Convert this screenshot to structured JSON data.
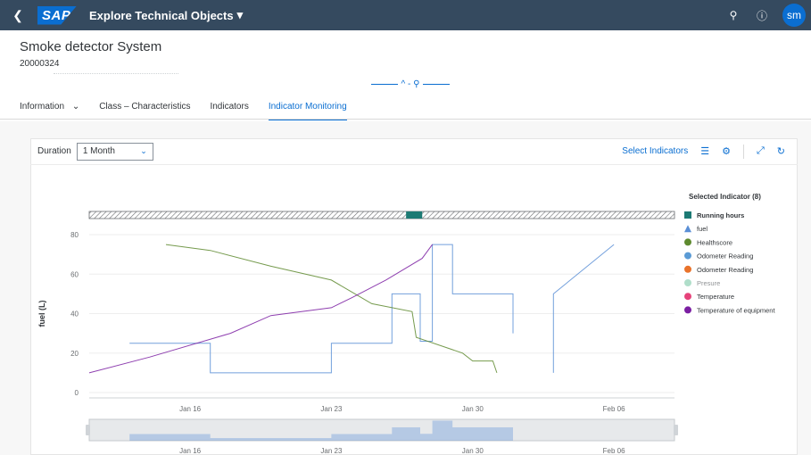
{
  "shell": {
    "title": "Explore Technical Objects",
    "logo": "SAP",
    "avatar_initials": "sm",
    "icons": [
      "back-icon",
      "search-icon",
      "help-icon"
    ]
  },
  "header": {
    "title": "Smoke detector System",
    "id": "20000324",
    "collapse_glyphs": "^ - ⚲"
  },
  "tabs": [
    {
      "label": "Information",
      "has_menu": true
    },
    {
      "label": "Class – Characteristics"
    },
    {
      "label": "Indicators"
    },
    {
      "label": "Indicator Monitoring",
      "active": true
    }
  ],
  "toolbar": {
    "duration_label": "Duration",
    "duration_value": "1 Month",
    "select_indicators": "Select Indicators"
  },
  "colors": {
    "shell_bg": "#354a5f",
    "accent": "#0a6ed1",
    "running_hours": "#1d7a74",
    "fuel": "#5a8fd6",
    "healthscore": "#5e8a2f",
    "odometer1": "#5b9bd5",
    "odometer2": "#e9732b",
    "presure": "#8fd0b4",
    "temperature": "#e6427a",
    "temp_equipment": "#7b1fa2"
  },
  "chart_data": {
    "type": "line",
    "ylabel": "fuel (L)",
    "ylim": [
      0,
      80
    ],
    "yticks": [
      0,
      20,
      40,
      60,
      80
    ],
    "x_ticks": [
      "Jan 16",
      "Jan 23",
      "Jan 30",
      "Feb 06"
    ],
    "legend_title": "Selected Indicator (8)",
    "legend": [
      {
        "name": "Running hours",
        "marker": "square",
        "color_key": "running_hours",
        "bold": true
      },
      {
        "name": "fuel",
        "marker": "triangle",
        "color_key": "fuel"
      },
      {
        "name": "Healthscore",
        "marker": "circle",
        "color_key": "healthscore"
      },
      {
        "name": "Odometer Reading",
        "marker": "circle",
        "color_key": "odometer1"
      },
      {
        "name": "Odometer Reading",
        "marker": "circle",
        "color_key": "odometer2"
      },
      {
        "name": "Presure",
        "marker": "circle",
        "color_key": "presure",
        "faded": true
      },
      {
        "name": "Temperature",
        "marker": "circle",
        "color_key": "temperature"
      },
      {
        "name": "Temperature of equipment",
        "marker": "circle",
        "color_key": "temp_equipment"
      }
    ],
    "x_domain": [
      11,
      40
    ],
    "series": [
      {
        "name": "fuel",
        "color_key": "fuel",
        "step": true,
        "points": [
          [
            13,
            25
          ],
          [
            17,
            25
          ],
          [
            17,
            10
          ],
          [
            23,
            10
          ],
          [
            23,
            25
          ],
          [
            26,
            25
          ],
          [
            26,
            50
          ],
          [
            27.4,
            50
          ],
          [
            27.4,
            26
          ],
          [
            28,
            26
          ],
          [
            28,
            75
          ],
          [
            29,
            75
          ],
          [
            29,
            50
          ],
          [
            32,
            50
          ],
          [
            32,
            30
          ]
        ]
      },
      {
        "name": "fuel",
        "color_key": "fuel",
        "step": true,
        "points": [
          [
            34,
            10
          ],
          [
            34,
            50
          ],
          [
            37,
            75
          ]
        ]
      },
      {
        "name": "Healthscore",
        "color_key": "healthscore",
        "step": false,
        "points": [
          [
            14.8,
            75
          ],
          [
            17,
            72
          ],
          [
            20,
            64
          ],
          [
            23,
            57
          ],
          [
            24,
            51
          ],
          [
            25,
            45
          ],
          [
            27,
            41
          ],
          [
            27.2,
            28
          ],
          [
            29.5,
            20
          ],
          [
            30,
            16
          ],
          [
            31,
            16
          ],
          [
            31.2,
            10
          ]
        ]
      },
      {
        "name": "Temperature of equipment",
        "color_key": "temp_equipment",
        "step": false,
        "points": [
          [
            11,
            10
          ],
          [
            14,
            18
          ],
          [
            18,
            30
          ],
          [
            20,
            39
          ],
          [
            23,
            43
          ],
          [
            24,
            48
          ],
          [
            25.7,
            57
          ],
          [
            27.5,
            68
          ],
          [
            28,
            75
          ]
        ]
      }
    ]
  }
}
